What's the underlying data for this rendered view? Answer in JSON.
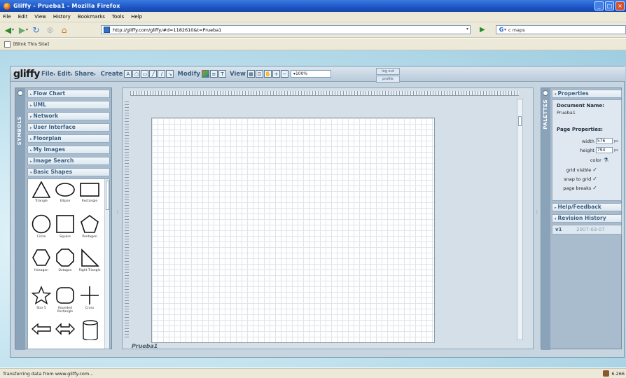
{
  "browser": {
    "window_title": "Gliffy - Prueba1 - Mozilla Firefox",
    "menu": [
      "File",
      "Edit",
      "View",
      "History",
      "Bookmarks",
      "Tools",
      "Help"
    ],
    "url": "http://gliffy.com/gliffy/#d=1182610&t=Prueba1",
    "search_text": "c maps",
    "search_engine_glyph": "G",
    "bookmark": "[Blink This Site]",
    "status": "Transferring data from www.gliffy.com...",
    "status_right": "6.266"
  },
  "app": {
    "logo": "gliffy",
    "menus": [
      {
        "label": "File"
      },
      {
        "label": "Edit"
      },
      {
        "label": "Share"
      }
    ],
    "groups": {
      "create": "Create",
      "modify": "Modify",
      "view": "View"
    },
    "zoom": "100%",
    "logout": "log out",
    "profile": "profile"
  },
  "symbols": {
    "tab_label": "SYMBOLS",
    "categories": [
      "Flow Chart",
      "UML",
      "Network",
      "User Interface",
      "Floorplan",
      "My Images",
      "Image Search",
      "Basic Shapes"
    ],
    "shapes": [
      {
        "label": "Triangle"
      },
      {
        "label": "Ellipse"
      },
      {
        "label": "Rectangle"
      },
      {
        "label": "Circle"
      },
      {
        "label": "Square"
      },
      {
        "label": "Pentagon"
      },
      {
        "label": "Hexagon"
      },
      {
        "label": "Octagon"
      },
      {
        "label": "Right Triangle"
      },
      {
        "label": "Star 5"
      },
      {
        "label": "Rounded Rectangle"
      },
      {
        "label": "Cross"
      }
    ]
  },
  "canvas": {
    "document_label": "Prueba1"
  },
  "palettes": {
    "tab_label": "PALETTES",
    "properties": {
      "header": "Properties",
      "doc_name_label": "Document Name:",
      "doc_name": "Prueba1",
      "page_props_label": "Page Properties:",
      "width_label": "width",
      "width_value": "576",
      "height_label": "height",
      "height_value": "794",
      "unit": "px",
      "color_label": "color",
      "grid_visible_label": "grid visible",
      "snap_to_grid_label": "snap to grid",
      "page_breaks_label": "page breaks",
      "grid_visible": true,
      "snap_to_grid": true,
      "page_breaks": true
    },
    "help_header": "Help/Feedback",
    "revision_header": "Revision History",
    "revision": {
      "version": "v1",
      "date": "2007-03-07"
    }
  }
}
